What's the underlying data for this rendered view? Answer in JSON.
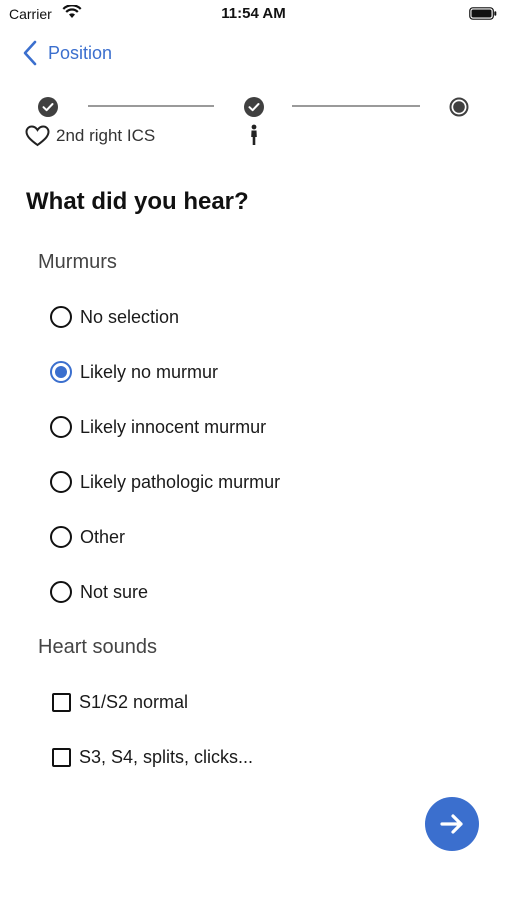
{
  "status_bar": {
    "carrier": "Carrier",
    "time": "11:54 AM"
  },
  "nav": {
    "back_label": "Position"
  },
  "stepper": {
    "steps": [
      {
        "state": "completed",
        "icon": "check-icon"
      },
      {
        "state": "completed",
        "icon": "check-icon"
      },
      {
        "state": "current",
        "icon": "current-step-icon"
      }
    ],
    "step1_sub_label": "2nd right ICS",
    "step1_sub_icon": "heart-icon",
    "step2_sub_icon": "person-icon"
  },
  "question": "What did you hear?",
  "murmurs": {
    "label": "Murmurs",
    "options": [
      {
        "label": "No selection",
        "selected": false
      },
      {
        "label": "Likely no murmur",
        "selected": true
      },
      {
        "label": "Likely innocent murmur",
        "selected": false
      },
      {
        "label": "Likely pathologic murmur",
        "selected": false
      },
      {
        "label": "Other",
        "selected": false
      },
      {
        "label": "Not sure",
        "selected": false
      }
    ]
  },
  "heart_sounds": {
    "label": "Heart sounds",
    "options": [
      {
        "label": "S1/S2 normal",
        "checked": false
      },
      {
        "label": "S3, S4, splits, clicks...",
        "checked": false
      }
    ]
  },
  "next_button": {
    "icon": "arrow-right-icon"
  },
  "colors": {
    "accent": "#3b6fce",
    "step_dot": "#404040",
    "line": "#9a9a9a"
  }
}
